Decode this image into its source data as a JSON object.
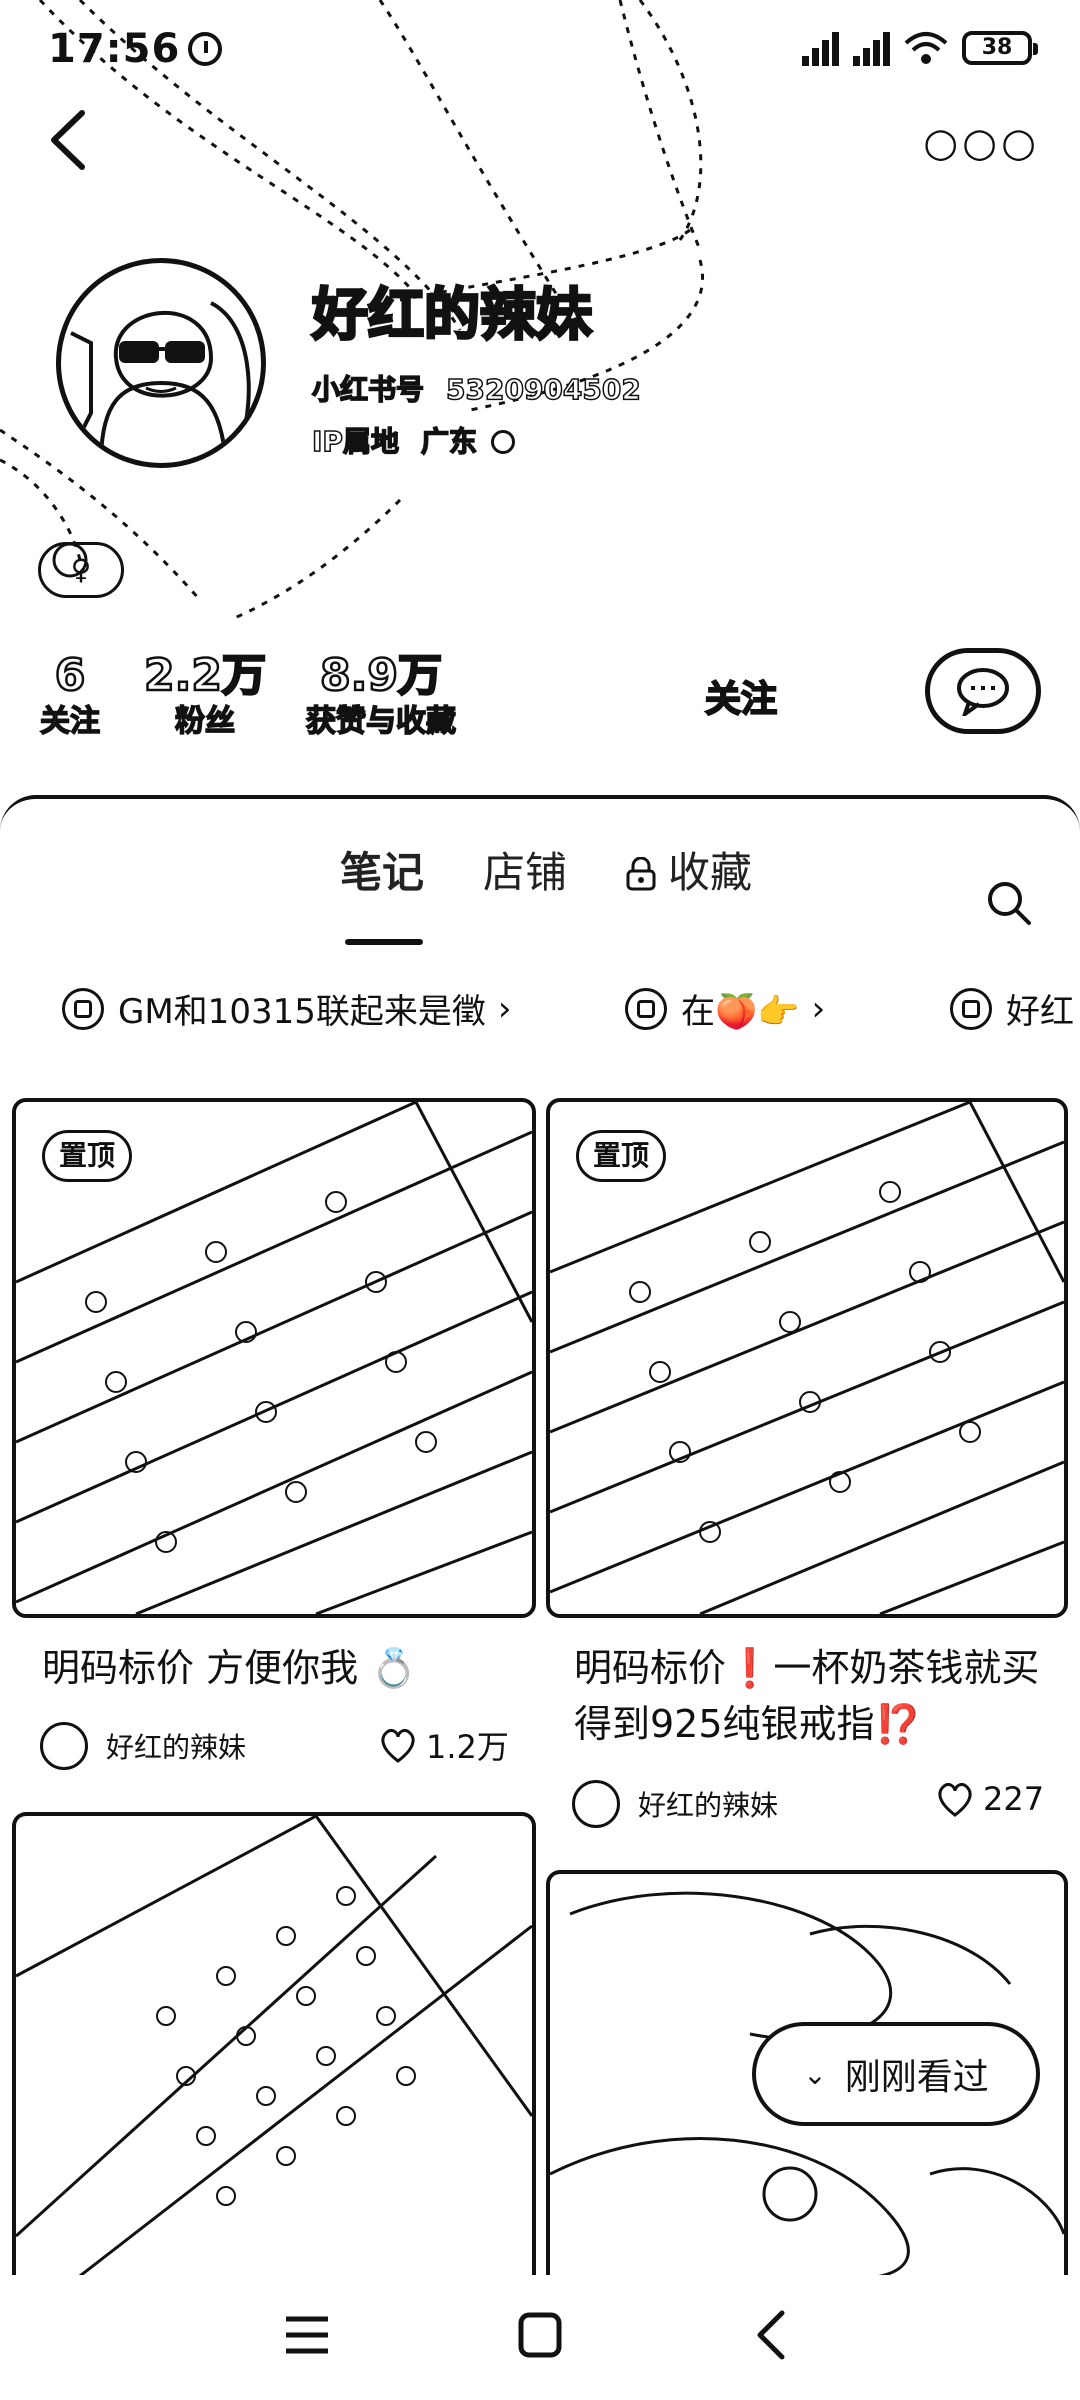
{
  "status_bar": {
    "time": "17:56",
    "battery": "38"
  },
  "profile": {
    "username": "好红的辣妹",
    "id_label": "小红书号",
    "id_value": "5320904502",
    "ip_label": "IP属地",
    "ip_value": "广东",
    "stats": [
      {
        "num": "6",
        "label": "关注"
      },
      {
        "num": "2.2万",
        "label": "粉丝"
      },
      {
        "num": "8.9万",
        "label": "获赞与收藏"
      }
    ],
    "follow_label": "关注"
  },
  "tabs": [
    {
      "label": "笔记",
      "active": true
    },
    {
      "label": "店铺",
      "active": false
    },
    {
      "label": "收藏",
      "active": false,
      "locked": true
    }
  ],
  "collections": [
    {
      "label": "GM和10315联起来是徵"
    },
    {
      "label": "在🍑👉"
    },
    {
      "label": "好红"
    }
  ],
  "notes": [
    {
      "title": "明码标价 方便你我 💍",
      "author": "好红的辣妹",
      "likes": "1.2万",
      "pinned": true,
      "pin_label": "置顶"
    },
    {
      "title": "明码标价❗一杯奶茶钱就买得到925纯银戒指⁉️",
      "author": "好红的辣妹",
      "likes": "227",
      "pinned": true,
      "pin_label": "置顶"
    },
    {
      "title": "",
      "author": "",
      "likes": "",
      "pinned": false
    },
    {
      "title": "",
      "author": "",
      "likes": "",
      "pinned": false
    }
  ],
  "recently_viewed_label": "刚刚看过"
}
